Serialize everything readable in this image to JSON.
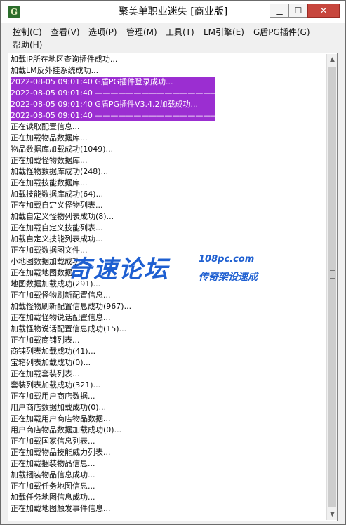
{
  "window": {
    "title": "聚美单职业迷失 [商业版]",
    "app_icon_glyph": "G",
    "buttons": {
      "minimize": "▁",
      "maximize": "☐",
      "close": "✕"
    }
  },
  "menu": {
    "items": [
      "控制(C)",
      "查看(V)",
      "选项(P)",
      "管理(M)",
      "工具(T)",
      "LM引擎(E)",
      "G盾PG插件(G)",
      "帮助(H)"
    ]
  },
  "log": {
    "lines": [
      {
        "text": "加载IP所在地区查询插件成功...",
        "selected": false
      },
      {
        "text": "加载LM反外挂系统成功...",
        "selected": false
      },
      {
        "text": "2022-08-05 09:01:40 G盾PG插件登录成功...",
        "selected": true
      },
      {
        "text": "2022-08-05 09:01:40 ——————————————————————",
        "selected": true
      },
      {
        "text": "2022-08-05 09:01:40 G盾PG插件V3.4.2加载成功...",
        "selected": true
      },
      {
        "text": "2022-08-05 09:01:40 ——————————————————————",
        "selected": true
      },
      {
        "text": "正在读取配置信息...",
        "selected": false
      },
      {
        "text": "正在加载物品数据库...",
        "selected": false
      },
      {
        "text": "物品数据库加载成功(1049)...",
        "selected": false
      },
      {
        "text": "正在加载怪物数据库...",
        "selected": false
      },
      {
        "text": "加载怪物数据库成功(248)...",
        "selected": false
      },
      {
        "text": "正在加载技能数据库...",
        "selected": false
      },
      {
        "text": "加载技能数据库成功(64)...",
        "selected": false
      },
      {
        "text": "正在加载自定义怪物列表...",
        "selected": false
      },
      {
        "text": "加载自定义怪物列表成功(8)...",
        "selected": false
      },
      {
        "text": "正在加载自定义技能列表...",
        "selected": false
      },
      {
        "text": "加载自定义技能列表成功...",
        "selected": false
      },
      {
        "text": "正在加载数据图文件...",
        "selected": false
      },
      {
        "text": "小地图数据加载成功...",
        "selected": false
      },
      {
        "text": "正在加载地图数据...",
        "selected": false
      },
      {
        "text": "地图数据加载成功(291)...",
        "selected": false
      },
      {
        "text": "正在加载怪物刷新配置信息...",
        "selected": false
      },
      {
        "text": "加载怪物刷新配置信息成功(967)...",
        "selected": false
      },
      {
        "text": "正在加载怪物说话配置信息...",
        "selected": false
      },
      {
        "text": "加载怪物说话配置信息成功(15)...",
        "selected": false
      },
      {
        "text": "正在加载商铺列表...",
        "selected": false
      },
      {
        "text": "商铺列表加载成功(41)...",
        "selected": false
      },
      {
        "text": "宝箱列表加载成功(0)...",
        "selected": false
      },
      {
        "text": "正在加载套装列表...",
        "selected": false
      },
      {
        "text": "套装列表加载成功(321)...",
        "selected": false
      },
      {
        "text": "正在加载用户商店数据...",
        "selected": false
      },
      {
        "text": "用户商店数据加载成功(0)...",
        "selected": false
      },
      {
        "text": "正在加载用户商店物品数据...",
        "selected": false
      },
      {
        "text": "用户商店物品数据加载成功(0)...",
        "selected": false
      },
      {
        "text": "正在加载国家信息列表...",
        "selected": false
      },
      {
        "text": "正在加载物品技能威力列表...",
        "selected": false
      },
      {
        "text": "正在加载捆装物品信息...",
        "selected": false
      },
      {
        "text": "加载捆装物品信息成功...",
        "selected": false
      },
      {
        "text": "正在加载任务地图信息...",
        "selected": false
      },
      {
        "text": "加载任务地图信息成功...",
        "selected": false
      },
      {
        "text": "正在加载地图触发事件信息...",
        "selected": false
      }
    ]
  },
  "scrollbar": {
    "up_arrow": "▲",
    "down_arrow": "▼"
  },
  "watermark": {
    "main": "奇速论坛",
    "domain": "108pc.com",
    "slogan": "传奇架设速成"
  },
  "colors": {
    "selection": "#9b2ed1",
    "watermark": "#1e5fd1",
    "close_button": "#c7463d"
  }
}
